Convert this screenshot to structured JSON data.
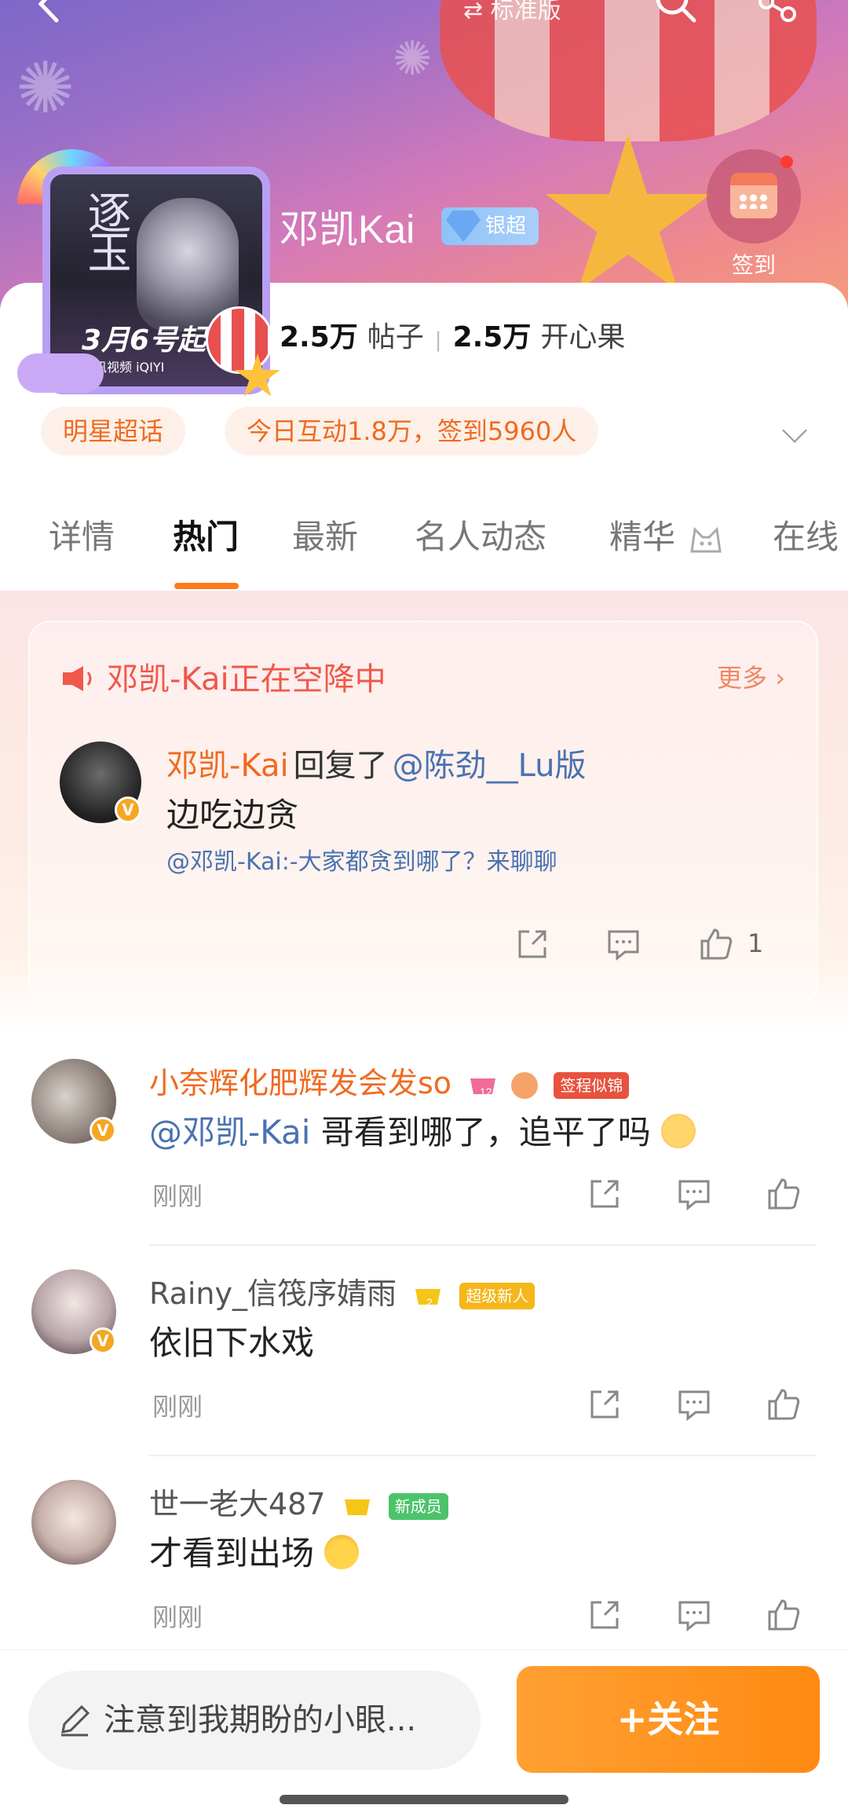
{
  "header": {
    "mode_switch": "⇄ 标准版",
    "topic_name": "邓凯Kai",
    "level_badge": "银超",
    "checkin_label": "签到"
  },
  "cover": {
    "title": "逐玉",
    "date_text": "3月6号起",
    "platforms": "腾讯视频 iQIYI"
  },
  "stats": {
    "posts_value": "2.5万",
    "posts_label": "帖子",
    "fans_value": "2.5万",
    "fans_label": "开心果"
  },
  "pills": {
    "category": "明星超话",
    "activity": "今日互动1.8万，签到5960人"
  },
  "tabs": [
    "详情",
    "热门",
    "最新",
    "名人动态",
    "精华",
    "在线"
  ],
  "airdrop": {
    "title": "邓凯-Kai正在空降中",
    "more": "更多 ›",
    "user": "邓凯-Kai",
    "reply_word": "回复了",
    "mention": "@陈劲__Lu版",
    "reply_text": "边吃边贪",
    "quoted": "@邓凯-Kai:-大家都贪到哪了？来聊聊",
    "like_count": "1"
  },
  "comments": [
    {
      "name": "小奈辉化肥辉发会发so",
      "name_color": "#f06a1f",
      "level": "12",
      "tag": "签程似锦",
      "tag_color": "#e8523f",
      "mention": "@邓凯-Kai",
      "text": " 哥看到哪了，追平了吗",
      "time": "刚刚"
    },
    {
      "name": "Rainy_信筏序婧雨",
      "name_color": "#555555",
      "level": "2",
      "tag": "超级新人",
      "tag_color": "#f5b619",
      "mention": "",
      "text": "依旧下水戏",
      "time": "刚刚"
    },
    {
      "name": "世一老大487",
      "name_color": "#555555",
      "level": "",
      "tag": "新成员",
      "tag_color": "#4cc36a",
      "mention": "",
      "text": "才看到出场",
      "time": "刚刚"
    }
  ],
  "bottom": {
    "input_placeholder": "注意到我期盼的小眼...",
    "follow_label": "+关注"
  },
  "colors": {
    "accent": "#ff8a12",
    "orange_text": "#f06a1f",
    "link_blue": "#4a72b0"
  }
}
